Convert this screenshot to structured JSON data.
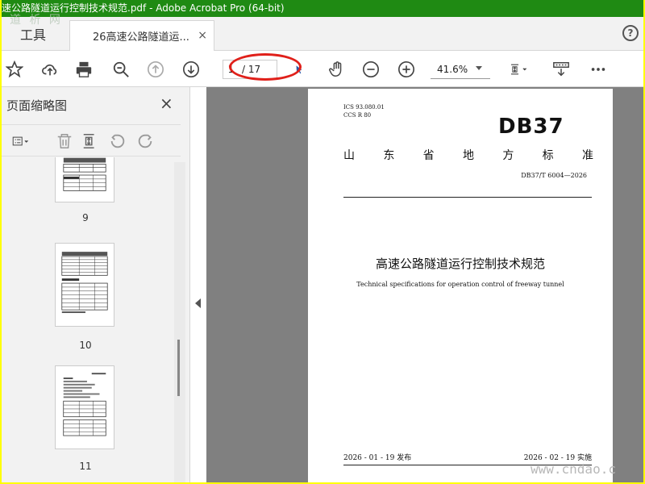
{
  "window": {
    "title": "速公路隧道运行控制技术规范.pdf - Adobe Acrobat Pro (64-bit)"
  },
  "watermark": {
    "top": "道 析 网",
    "bottom": "www.cndao.c"
  },
  "tabs": {
    "tools_label": "工具",
    "doc_label": "26高速公路隧道运...",
    "close_glyph": "×",
    "help_glyph": "?"
  },
  "toolbar": {
    "page_current": "1",
    "page_total": "/ 17",
    "zoom": "41.6%"
  },
  "sidebar": {
    "title": "页面缩略图",
    "close_glyph": "×",
    "thumbnails": [
      {
        "label": "9"
      },
      {
        "label": "10"
      },
      {
        "label": "11"
      }
    ]
  },
  "document": {
    "ics_line1": "ICS  93.080.01",
    "ics_line2": "CCS  R 80",
    "db_code": "DB37",
    "standard_chars": [
      "山",
      "东",
      "省",
      "地",
      "方",
      "标",
      "准"
    ],
    "std_number": "DB37/T 6004—2026",
    "title_cn": "高速公路隧道运行控制技术规范",
    "title_en": "Technical specifications for operation control of freeway tunnel",
    "date_issue": "2026 - 01 - 19 发布",
    "date_effective": "2026 - 02 - 19 实施"
  },
  "colors": {
    "titlebar": "#1f8a13",
    "highlight": "#e0201a",
    "border": "#ffff00"
  }
}
